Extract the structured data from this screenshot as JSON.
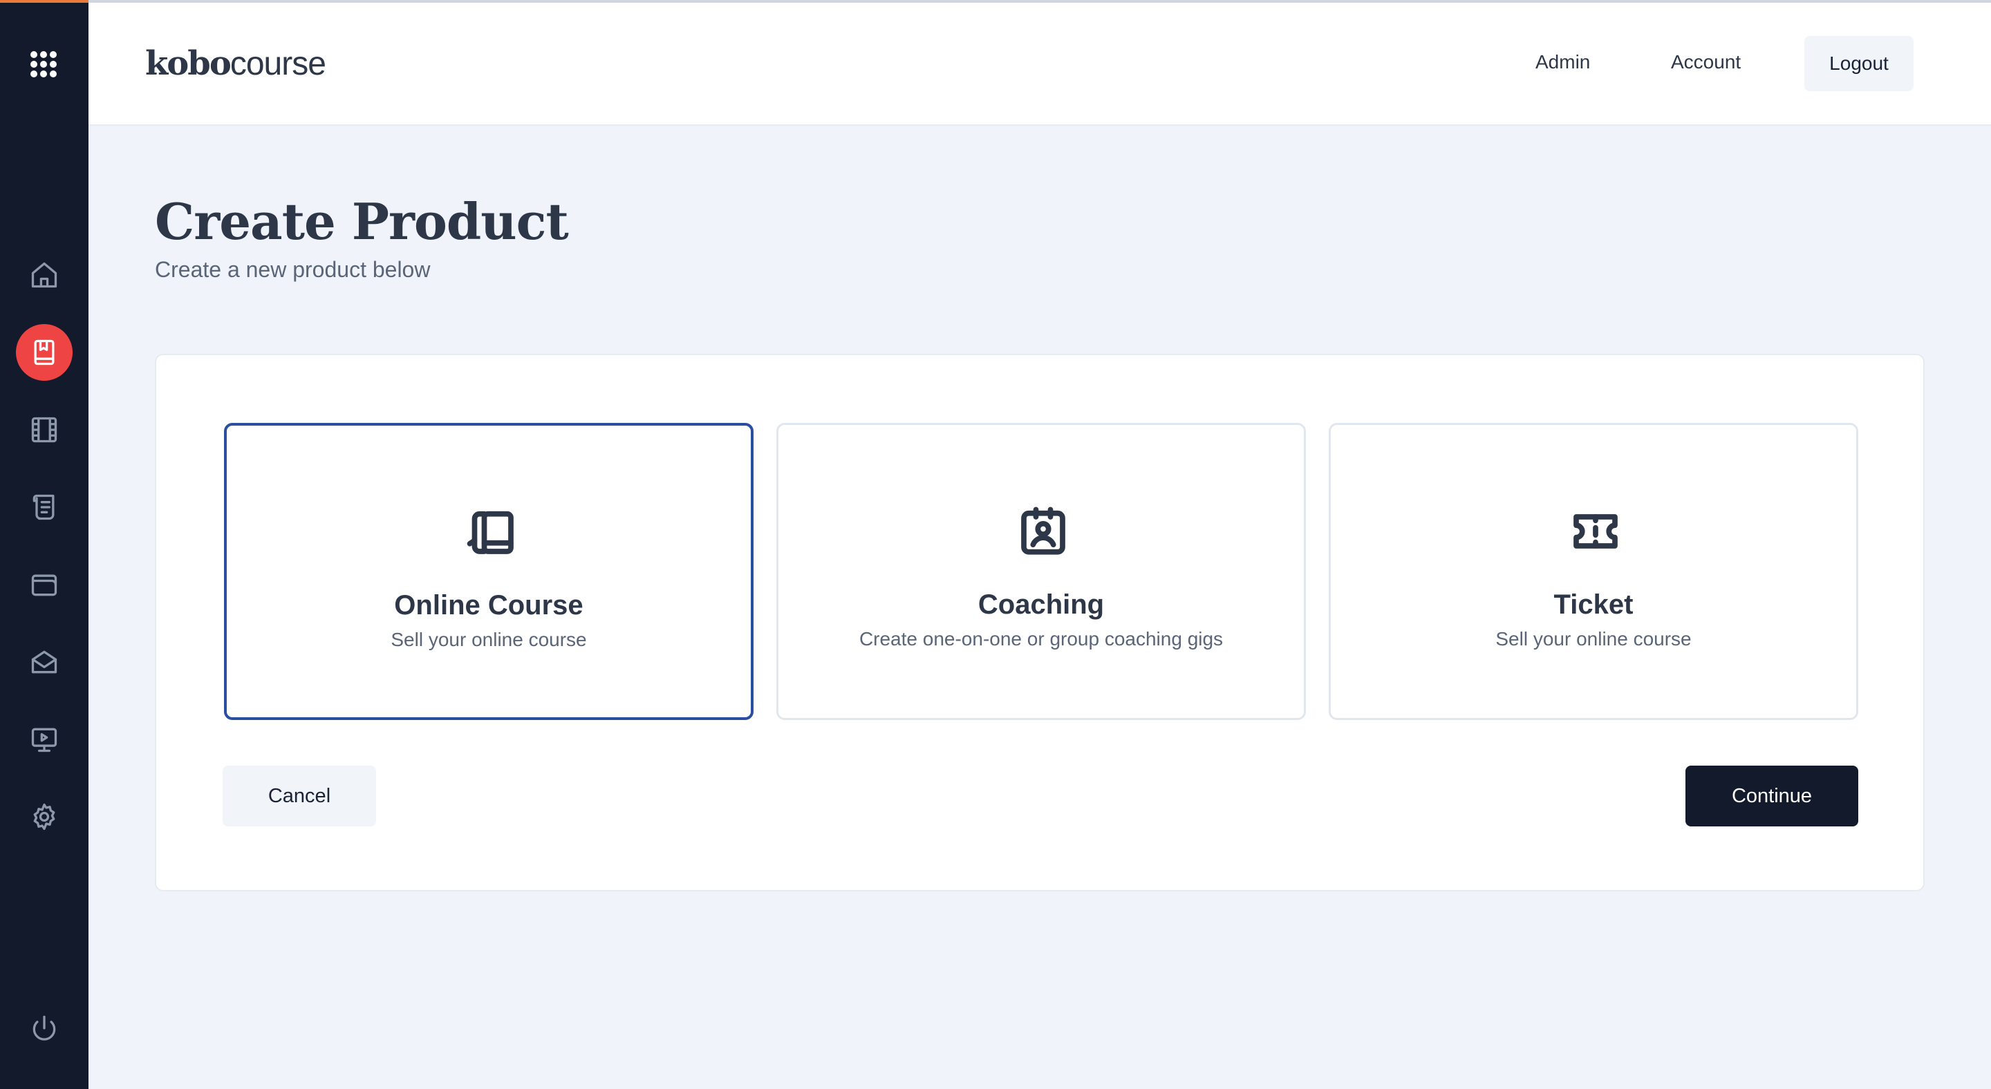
{
  "app": {
    "logo_bold": "kobo",
    "logo_light": "course"
  },
  "header": {
    "nav": [
      "Admin",
      "Account"
    ],
    "logout_label": "Logout"
  },
  "sidebar": {
    "top_icon": "apps-grid-icon",
    "items": [
      {
        "icon": "home-icon",
        "active": false
      },
      {
        "icon": "book-icon",
        "active": true
      },
      {
        "icon": "film-icon",
        "active": false
      },
      {
        "icon": "scroll-icon",
        "active": false
      },
      {
        "icon": "wallet-icon",
        "active": false
      },
      {
        "icon": "mail-icon",
        "active": false
      },
      {
        "icon": "presentation-icon",
        "active": false
      },
      {
        "icon": "settings-icon",
        "active": false
      }
    ],
    "bottom_icon": "power-icon"
  },
  "page": {
    "title": "Create Product",
    "subtitle": "Create a new product below"
  },
  "options": [
    {
      "title": "Online Course",
      "description": "Sell your online course",
      "icon": "books-icon",
      "selected": true
    },
    {
      "title": "Coaching",
      "description": "Create one-on-one or group coaching gigs",
      "icon": "user-badge-icon",
      "selected": false
    },
    {
      "title": "Ticket",
      "description": "Sell your online course",
      "icon": "ticket-icon",
      "selected": false
    }
  ],
  "actions": {
    "cancel_label": "Cancel",
    "continue_label": "Continue"
  },
  "colors": {
    "sidebar_bg": "#131a2c",
    "active_accent": "#ef4444",
    "selected_border": "#2b4fa0",
    "page_bg": "#f0f4fa",
    "primary_button": "#131a2c"
  }
}
